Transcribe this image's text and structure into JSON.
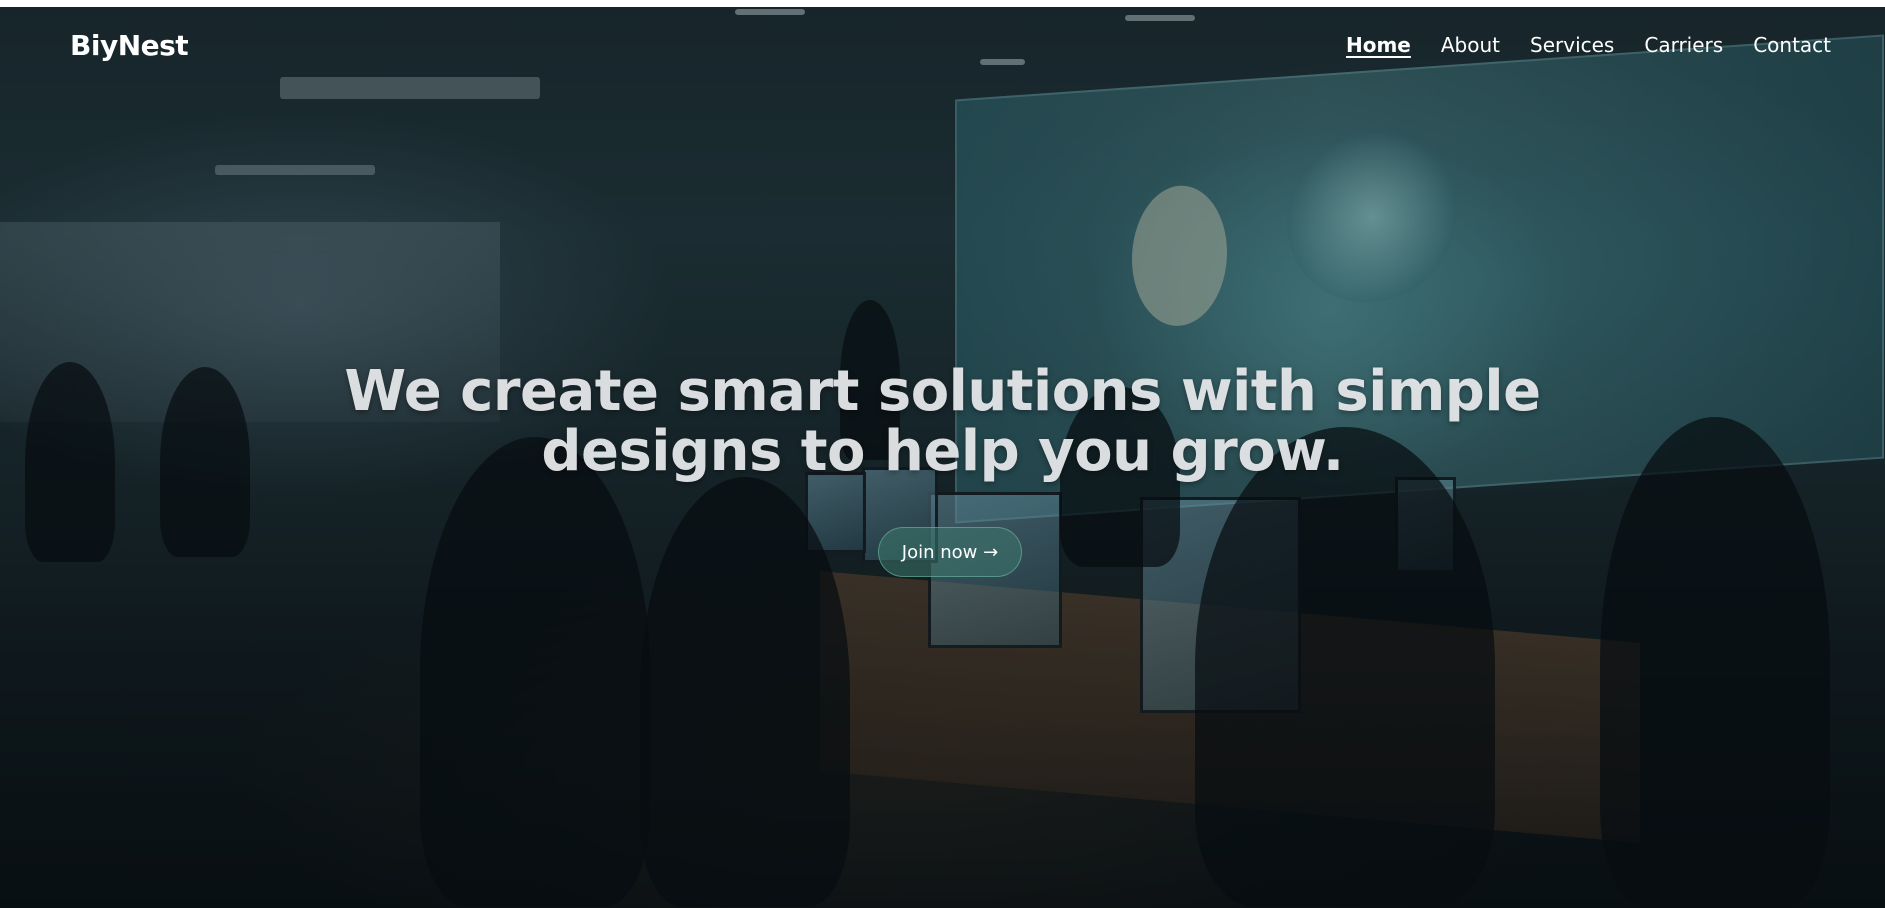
{
  "brand": {
    "name": "BiyNest"
  },
  "nav": {
    "items": [
      {
        "label": "Home",
        "active": true
      },
      {
        "label": "About",
        "active": false
      },
      {
        "label": "Services",
        "active": false
      },
      {
        "label": "Carriers",
        "active": false
      },
      {
        "label": "Contact",
        "active": false
      }
    ]
  },
  "hero": {
    "headline_line1": "We create smart solutions with simple",
    "headline_line2": "designs to help you grow.",
    "cta_label": "Join now →",
    "background_image": "photo of a dark open-plan office with people working at desks and a large teal video wall",
    "colors": {
      "text": "#e6e8ea",
      "cta_background": "#3c786e",
      "cta_border": "#78c8af"
    }
  }
}
